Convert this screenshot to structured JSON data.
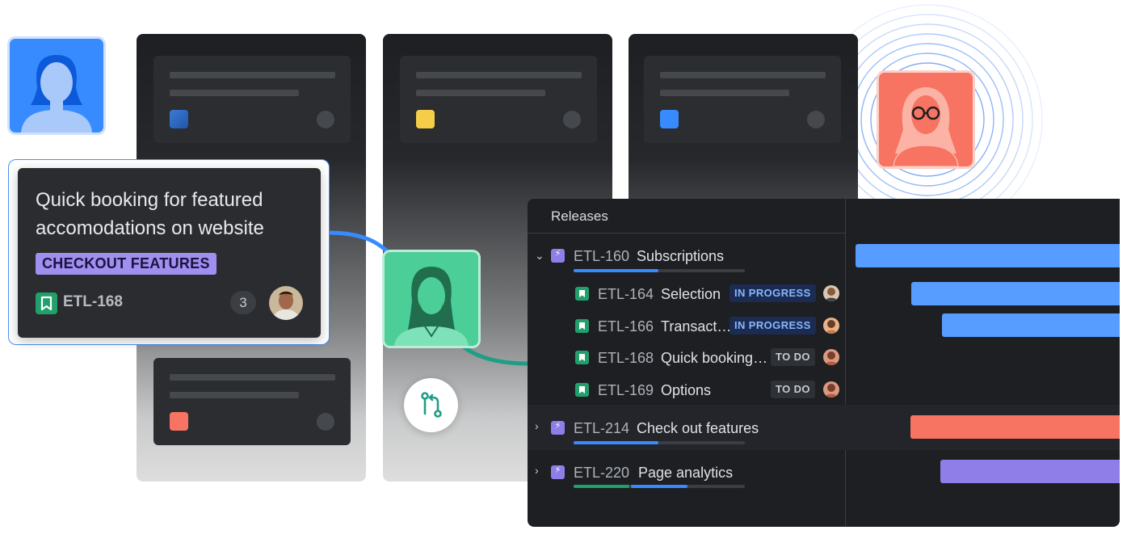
{
  "feature_card": {
    "title": "Quick booking for featured accomodations on website",
    "tag": "CHECKOUT FEATURES",
    "issue_key": "ETL-168",
    "count": "3"
  },
  "releases": {
    "header": "Releases",
    "rows": [
      {
        "key": "ETL-160",
        "name": "Subscriptions",
        "type": "epic",
        "expanded": true
      },
      {
        "key": "ETL-164",
        "name": "Selection",
        "type": "story",
        "status": "IN PROGRESS"
      },
      {
        "key": "ETL-166",
        "name": "Transact…",
        "type": "story",
        "status": "IN PROGRESS"
      },
      {
        "key": "ETL-168",
        "name": "Quick booking…",
        "type": "story",
        "status": "TO DO"
      },
      {
        "key": "ETL-169",
        "name": "Options",
        "type": "story",
        "status": "TO DO"
      },
      {
        "key": "ETL-214",
        "name": "Check out features",
        "type": "epic",
        "expanded": false
      },
      {
        "key": "ETL-220",
        "name": "Page analytics",
        "type": "epic",
        "expanded": false
      }
    ]
  },
  "colors": {
    "accent_blue": "#579dff",
    "coral": "#f87462",
    "purple": "#8f7ee7",
    "green": "#22a06b",
    "yellow": "#f5cd47"
  },
  "icons": [
    "user-avatar-icon",
    "git-pull-request-icon",
    "story-icon",
    "epic-icon",
    "chevron-down-icon",
    "chevron-right-icon"
  ]
}
